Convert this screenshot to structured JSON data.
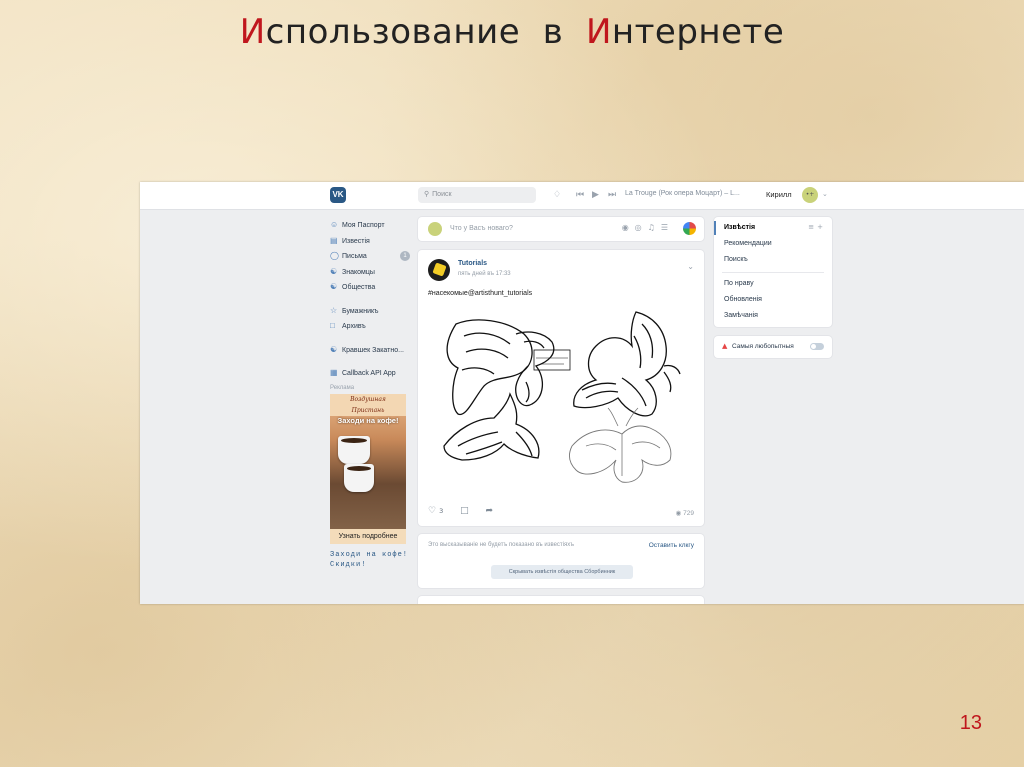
{
  "slide": {
    "title_initial_1": "И",
    "title_rest_1": "спользование",
    "title_middle": "в",
    "title_initial_2": "И",
    "title_rest_2": "нтернете",
    "page_number": "13"
  },
  "vk": {
    "logo": "VK",
    "search_placeholder": "Поиск",
    "now_playing": "La Trouge (Рок опера Моцарт) – L...",
    "user_name": "Кирилл",
    "avatar_initials": "•+",
    "nav": [
      {
        "label": "Моя Паспорт",
        "icon": "user-icon"
      },
      {
        "label": "Известія",
        "icon": "news-icon"
      },
      {
        "label": "Письма",
        "icon": "messages-icon",
        "badge": "1"
      },
      {
        "label": "Знакомцы",
        "icon": "friends-icon"
      },
      {
        "label": "Общества",
        "icon": "communities-icon"
      },
      {
        "label": "Бумажникъ",
        "icon": "bookmark-icon"
      },
      {
        "label": "Архивъ",
        "icon": "archive-icon"
      },
      {
        "label": "Кравшек Закатно...",
        "icon": "group-icon"
      },
      {
        "label": "Callback API App",
        "icon": "app-icon"
      }
    ],
    "ads_label": "Реклама",
    "ad": {
      "top_line_1": "Воздушная",
      "top_line_2": "Пристань",
      "headline": "Заходи на кофе!",
      "button": "Узнать подробнее",
      "caption_1": "Заходи на кофе!",
      "caption_2": "Скидки!"
    },
    "composer_placeholder": "Что у Васъ новаго?",
    "post": {
      "author": "Tutorials",
      "time": "пять дней въ 17:33",
      "text": "#насекомые@artisthunt_tutorials",
      "likes": "3",
      "views": "729"
    },
    "hidden_notice": {
      "text": "Это высказываніе не будетъ показано въ известіяхъ",
      "cancel": "Оставить клкгу",
      "button": "Скрывать извѣстія общества Сборбинник"
    },
    "right_menu": [
      "Извѣстія",
      "Рекомендации",
      "Поискъ",
      "По нраву",
      "Обновленія",
      "Замѣчанія"
    ],
    "popular_label": "Самыя любопытныя"
  }
}
